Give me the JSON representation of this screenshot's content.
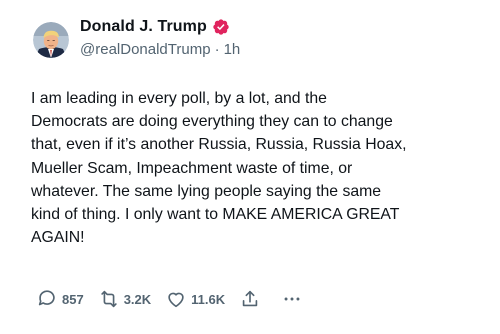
{
  "tweet": {
    "display_name": "Donald J. Trump",
    "handle": "@realDonaldTrump",
    "separator": "·",
    "time": "1h",
    "text": "I am leading in every poll, by a lot, and the\nDemocrats are doing everything they can to change\nthat, even if it’s another Russia, Russia, Russia Hoax,\nMueller Scam, Impeachment waste of time, or\nwhatever. The same lying people saying the same\nkind of thing. I only want to MAKE AMERICA GREAT\nAGAIN!",
    "verified_icon": "verified-badge-icon",
    "verified_color": "#e0245e"
  },
  "actions": {
    "replies": "857",
    "retweets": "3.2K",
    "likes": "11.6K",
    "reply_icon": "reply-icon",
    "retweet_icon": "retweet-icon",
    "like_icon": "heart-icon",
    "share_icon": "share-icon",
    "more_icon": "more-icon"
  },
  "colors": {
    "text": "#0f1419",
    "secondary": "#536471",
    "background": "#ffffff"
  }
}
